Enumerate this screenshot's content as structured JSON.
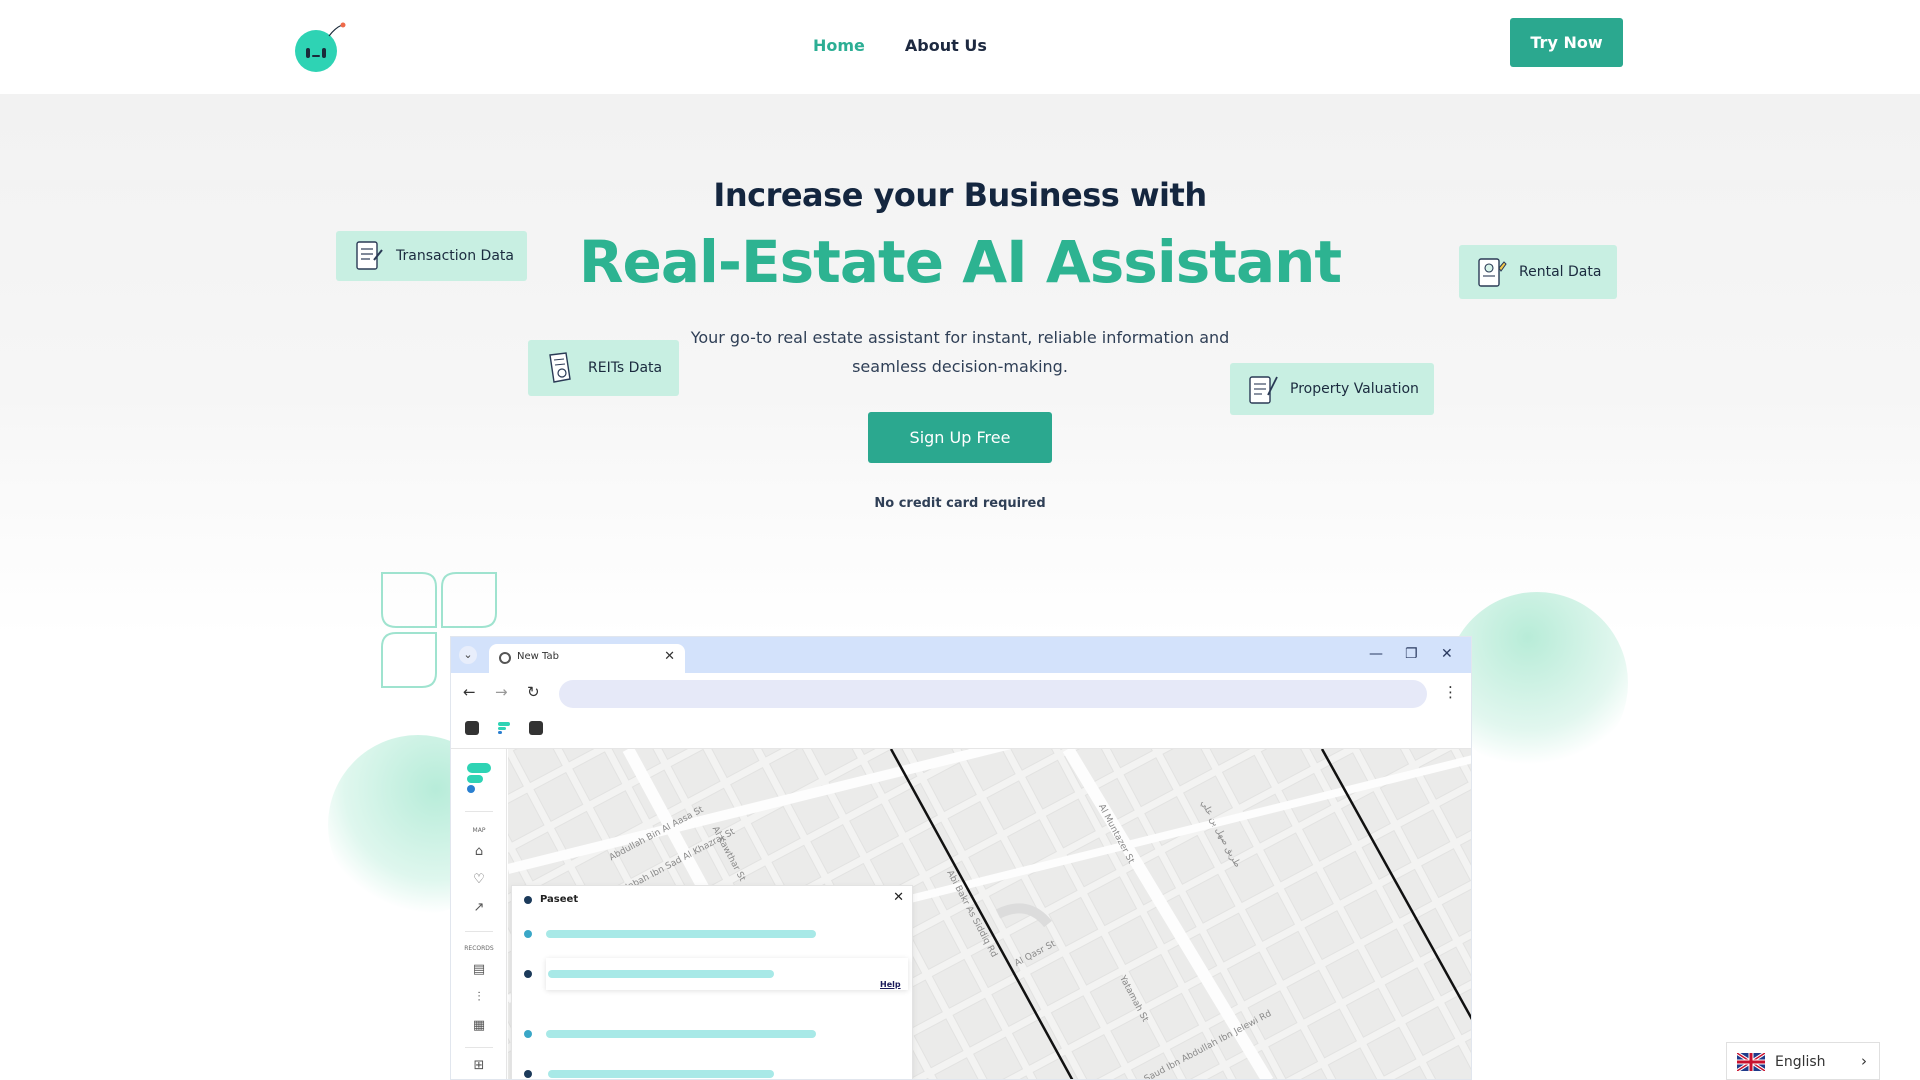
{
  "header": {
    "nav": [
      {
        "label": "Home"
      },
      {
        "label": "About Us"
      }
    ],
    "cta_label": "Try Now"
  },
  "hero": {
    "kicker": "Increase your Business with",
    "headline": "Real-Estate AI Assistant",
    "subtext": "Your go-to real estate assistant for instant, reliable information and seamless decision-making.",
    "signup_label": "Sign Up Free",
    "note": "No credit card required",
    "chips": {
      "transaction": "Transaction Data",
      "reits": "REITs Data",
      "rental": "Rental Data",
      "valuation": "Property Valuation"
    }
  },
  "browser": {
    "tab_title": "New Tab",
    "sidebar_sections": [
      "MAP",
      "RECORDS"
    ],
    "panel_title": "Paseet",
    "panel_help": "Help",
    "map_streets": [
      "Abdullah Bin Al Aasa St",
      "Thalabah Ibn Sad Al Khazraj St",
      "Al Kawthar St",
      "Al Muntazer St",
      "Abi Bakr As Siddiq Rd",
      "Al Qasr St",
      "Yatamah St",
      "طريق صهل بن علي",
      "Prince Saud Ibn Abdullah Ibn Jelewi Rd"
    ]
  },
  "language": {
    "label": "English"
  },
  "colors": {
    "accent": "#2ba88f",
    "headline": "#2db391",
    "chip": "#c8efe2",
    "tabbar": "#d3e2fb"
  },
  "icons": [
    "logo-icon",
    "document-icon",
    "reits-document-icon",
    "rental-document-icon",
    "valuation-icon",
    "chrome-icon",
    "back-icon",
    "forward-icon",
    "reload-icon",
    "kebab-icon",
    "extension-icon",
    "home-icon",
    "heart-icon",
    "share-icon",
    "file-icon",
    "chart-icon",
    "grid-icon",
    "gift-icon",
    "uk-flag-icon",
    "chevron-right-icon"
  ]
}
